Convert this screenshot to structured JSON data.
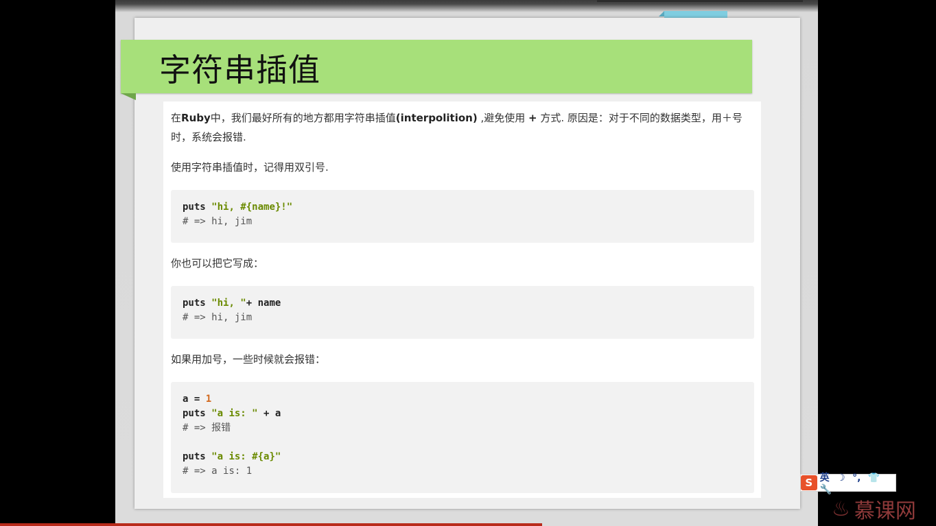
{
  "slide": {
    "title": "字符串插值",
    "para1_a": "在",
    "para1_b": "Ruby",
    "para1_c": "中，我们最好所有的地方都用字符串插值",
    "para1_d": "(interpolition)",
    "para1_e": " ,避免使用 ",
    "para1_f": "+",
    "para1_g": "   方式.  原因是：对于不同的数据类型，用＋号时，系统会报错.",
    "para2": "使用字符串插值时，记得用双引号.",
    "code1": {
      "line1_kw": "puts",
      "line1_str": "\"hi, #{name}!\"",
      "line2": "# => hi, jim"
    },
    "para3": "你也可以把它写成：",
    "code2": {
      "line1_kw": "puts",
      "line1_str": "\"hi, \"",
      "line1_rest": "+ name",
      "line2": "# => hi, jim"
    },
    "para4": "如果用加号，一些时候就会报错：",
    "code3": {
      "l1_a": "a = ",
      "l1_num": "1",
      "l2_kw": "puts",
      "l2_str": "\"a is: \"",
      "l2_rest": " + a",
      "l3": "# => 报错",
      "l5_kw": "puts",
      "l5_str": "\"a is: #{a}\"",
      "l6": "# => a is: 1"
    }
  },
  "overlay": {
    "ime_logo": "S",
    "ime_items": [
      "英",
      "☽",
      "°,",
      "👕",
      "🔧"
    ],
    "brand": "慕课网"
  }
}
